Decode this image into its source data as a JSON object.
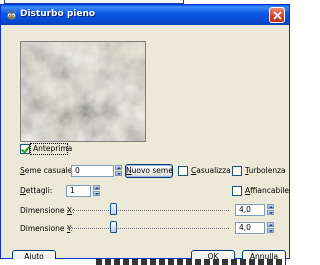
{
  "window": {
    "title": "Disturbo pieno",
    "title_icon": "wilber-icon",
    "close_icon": "close-icon"
  },
  "preview": {
    "toggle_label": "Anteprima",
    "checked": true
  },
  "form": {
    "seed_label_first": "S",
    "seed_label_rest": "eme casuale:",
    "seed_value": "0",
    "new_seed_button_first": "N",
    "new_seed_button_rest": "uovo seme",
    "randomize_label_first": "C",
    "randomize_label_rest": "asualizza",
    "randomize_checked": false,
    "turbulent_label_first": "T",
    "turbulent_label_rest": "urbolenza",
    "turbulent_checked": false,
    "detail_label_first": "D",
    "detail_label_rest": "ettagli:",
    "detail_value": "1",
    "tileable_label_first": "A",
    "tileable_label_rest": "ffiancabile",
    "tileable_checked": false,
    "size_x_label_pre": "Dimensione ",
    "size_x_label_key": "X",
    "size_x_label_post": ":",
    "size_x_value": "4,0",
    "size_x_level": 0.29,
    "size_y_label_pre": "Dimensione ",
    "size_y_label_key": "Y",
    "size_y_label_post": ":",
    "size_y_value": "4,0",
    "size_y_level": 0.29
  },
  "buttons": {
    "help": "Aiuto",
    "ok_first": "O",
    "ok_rest": "K",
    "cancel_first": "A",
    "cancel_rest": "nnulla"
  },
  "colors": {
    "titlebar": "#0a54e3",
    "dialog_bg": "#ece9d8",
    "checkmark": "#21a121",
    "slider_fill": "#3a9c3a"
  }
}
